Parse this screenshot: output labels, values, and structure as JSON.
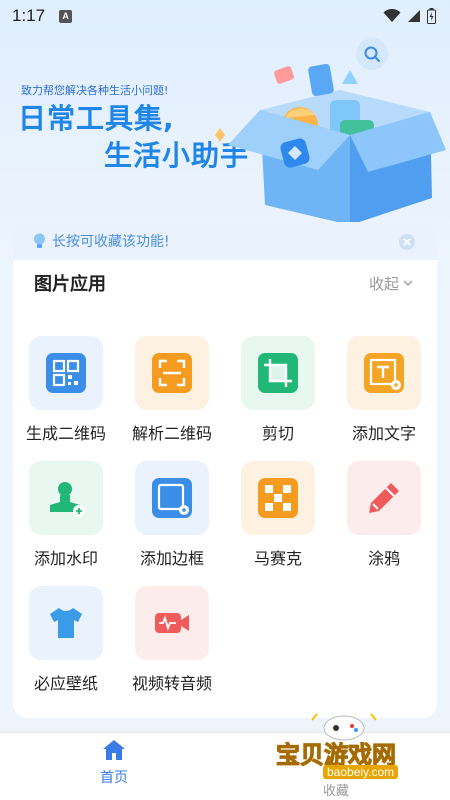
{
  "status": {
    "time": "1:17",
    "badge": "A"
  },
  "hero": {
    "subtitle": "致力帮您解决各种生活小问题!",
    "title_line1": "日常工具集,",
    "title_line2": "生活小助手"
  },
  "tip": {
    "text": "长按可收藏该功能!"
  },
  "section": {
    "title": "图片应用",
    "collapse_label": "收起"
  },
  "tools": [
    {
      "label": "生成二维码",
      "icon": "qrcode-icon",
      "bg": "#eaf2fd",
      "color": "#3a8ee8"
    },
    {
      "label": "解析二维码",
      "icon": "scan-icon",
      "bg": "#fdf1e2",
      "color": "#f59b1f"
    },
    {
      "label": "剪切",
      "icon": "crop-icon",
      "bg": "#e8f7ef",
      "color": "#21b776"
    },
    {
      "label": "添加文字",
      "icon": "text-icon",
      "bg": "#fdf1e2",
      "color": "#f5a524"
    },
    {
      "label": "添加水印",
      "icon": "watermark-icon",
      "bg": "#e8f7ef",
      "color": "#21b776"
    },
    {
      "label": "添加边框",
      "icon": "border-icon",
      "bg": "#eaf2fd",
      "color": "#3a8ee8"
    },
    {
      "label": "马赛克",
      "icon": "mosaic-icon",
      "bg": "#fdf1e2",
      "color": "#f59b1f"
    },
    {
      "label": "涂鸦",
      "icon": "pencil-icon",
      "bg": "#fdecec",
      "color": "#ef5b5b"
    },
    {
      "label": "必应壁纸",
      "icon": "tshirt-icon",
      "bg": "#eaf2fd",
      "color": "#3a9be8"
    },
    {
      "label": "视频转音频",
      "icon": "video-audio-icon",
      "bg": "#fdecec",
      "color": "#ef5b5b"
    }
  ],
  "nav": {
    "home_label": "首页"
  },
  "watermark": {
    "text": "宝贝游戏网",
    "url": "baobeiy.com",
    "partial": "收藏"
  },
  "colors": {
    "accent": "#1f86e8",
    "tip_bg": "#e9f2fd",
    "nav_active": "#3a7be6"
  }
}
